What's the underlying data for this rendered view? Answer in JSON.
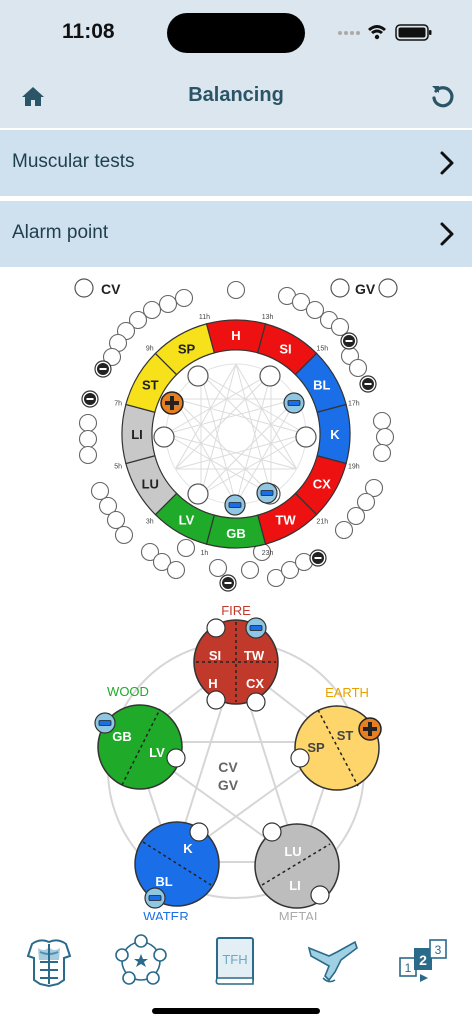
{
  "status": {
    "time": "11:08"
  },
  "header": {
    "title": "Balancing",
    "home_icon": "home-icon",
    "reset_icon": "reset-icon"
  },
  "menu": [
    {
      "label": "Muscular tests"
    },
    {
      "label": "Alarm point"
    }
  ],
  "wheel": {
    "outer_labels": {
      "cv": "CV",
      "gv": "GV"
    },
    "segments": [
      {
        "code": "H",
        "color": "#ee1111",
        "hour": "11h"
      },
      {
        "code": "SI",
        "color": "#ee1111",
        "hour": "13h"
      },
      {
        "code": "BL",
        "color": "#1a6fe8",
        "hour": "15h"
      },
      {
        "code": "K",
        "color": "#1a6fe8",
        "hour": "17h"
      },
      {
        "code": "CX",
        "color": "#ee1111",
        "hour": "19h"
      },
      {
        "code": "TW",
        "color": "#ee1111",
        "hour": "21h"
      },
      {
        "code": "GB",
        "color": "#1faa2a",
        "hour": "23h"
      },
      {
        "code": "LV",
        "color": "#1faa2a",
        "hour": "1h"
      },
      {
        "code": "LU",
        "color": "#c8c8c8",
        "hour": "3h"
      },
      {
        "code": "LI",
        "color": "#c8c8c8",
        "hour": "5h"
      },
      {
        "code": "ST",
        "color": "#f7e11a",
        "hour": "7h"
      },
      {
        "code": "SP",
        "color": "#f7e11a",
        "hour": "9h"
      }
    ]
  },
  "elements": {
    "center_cv": "CV",
    "center_gv": "GV",
    "fire": {
      "name": "FIRE",
      "color": "#c0392b",
      "labels": [
        "SI",
        "TW",
        "H",
        "CX"
      ]
    },
    "earth": {
      "name": "EARTH",
      "color": "#e8a000",
      "labels": [
        "SP",
        "ST"
      ]
    },
    "metal": {
      "name": "METAL",
      "color": "#aaaaaa",
      "labels": [
        "LU",
        "LI"
      ]
    },
    "water": {
      "name": "WATER",
      "color": "#1a6fe8",
      "labels": [
        "K",
        "BL"
      ]
    },
    "wood": {
      "name": "WOOD",
      "color": "#1faa2a",
      "labels": [
        "GB",
        "LV"
      ]
    }
  },
  "tabs": [
    {
      "icon": "muscle-body-icon"
    },
    {
      "icon": "five-elements-icon"
    },
    {
      "icon": "tfh-book-icon",
      "label": "TFH"
    },
    {
      "icon": "arm-test-icon"
    },
    {
      "icon": "sequence-numbers-icon",
      "label_a": "1",
      "label_b": "2",
      "label_c": "3"
    }
  ]
}
